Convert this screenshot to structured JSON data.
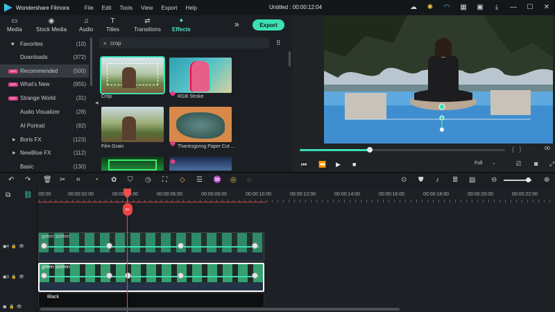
{
  "app": {
    "name": "Wondershare Filmora",
    "project_title": "Untitled : 00:00:12:04",
    "menu": [
      "File",
      "Edit",
      "Tools",
      "View",
      "Export",
      "Help"
    ]
  },
  "tabs": [
    {
      "label": "Media",
      "icon": "folder-icon"
    },
    {
      "label": "Stock Media",
      "icon": "camera-icon"
    },
    {
      "label": "Audio",
      "icon": "music-icon"
    },
    {
      "label": "Titles",
      "icon": "text-icon"
    },
    {
      "label": "Transitions",
      "icon": "transition-icon"
    },
    {
      "label": "Effects",
      "icon": "sparkle-icon",
      "active": true
    }
  ],
  "export_label": "Export",
  "sidebar": {
    "items": [
      {
        "label": "Favorites",
        "count": "(10)"
      },
      {
        "label": "Downloads",
        "count": "(372)"
      },
      {
        "label": "Recommended",
        "count": "(500)",
        "badge": "HOT",
        "active": true
      },
      {
        "label": "What's New",
        "count": "(955)",
        "badge": "HOT"
      },
      {
        "label": "Strange World",
        "count": "(31)",
        "badge": "HOT"
      },
      {
        "label": "Audio Visualizer",
        "count": "(28)"
      },
      {
        "label": "AI Portrait",
        "count": "(92)"
      },
      {
        "label": "Boris FX",
        "count": "(123)"
      },
      {
        "label": "NewBlue FX",
        "count": "(112)"
      },
      {
        "label": "Basic",
        "count": "(130)"
      }
    ]
  },
  "search": {
    "value": "crop"
  },
  "effects": [
    {
      "label": "Crop"
    },
    {
      "label": "RGB Stroke"
    },
    {
      "label": "Film Grain"
    },
    {
      "label": "Thanksgiving Paper Cut ..."
    }
  ],
  "preview": {
    "timecode": "00",
    "quality": "Full"
  },
  "ruler": {
    "labels": [
      ":00:00",
      "00:00:02:00",
      "00:00:04:00",
      "00:00:06:00",
      "00:00:08:00",
      "00:00:10:00",
      "00:00:12:00",
      "00:00:14:00",
      "00:00:16:00",
      "00:00:18:00",
      "00:00:20:00",
      "00:00:22:00"
    ]
  },
  "tracks": [
    {
      "number": "4",
      "clip_label": "green screen"
    },
    {
      "number": "3",
      "clip_label": "green screen"
    },
    {
      "number": "",
      "clip_label": "Black"
    }
  ],
  "colors": {
    "accent": "#3be0b4",
    "playhead": "#ee4d4d",
    "hot_badge": "#e33d8a"
  }
}
